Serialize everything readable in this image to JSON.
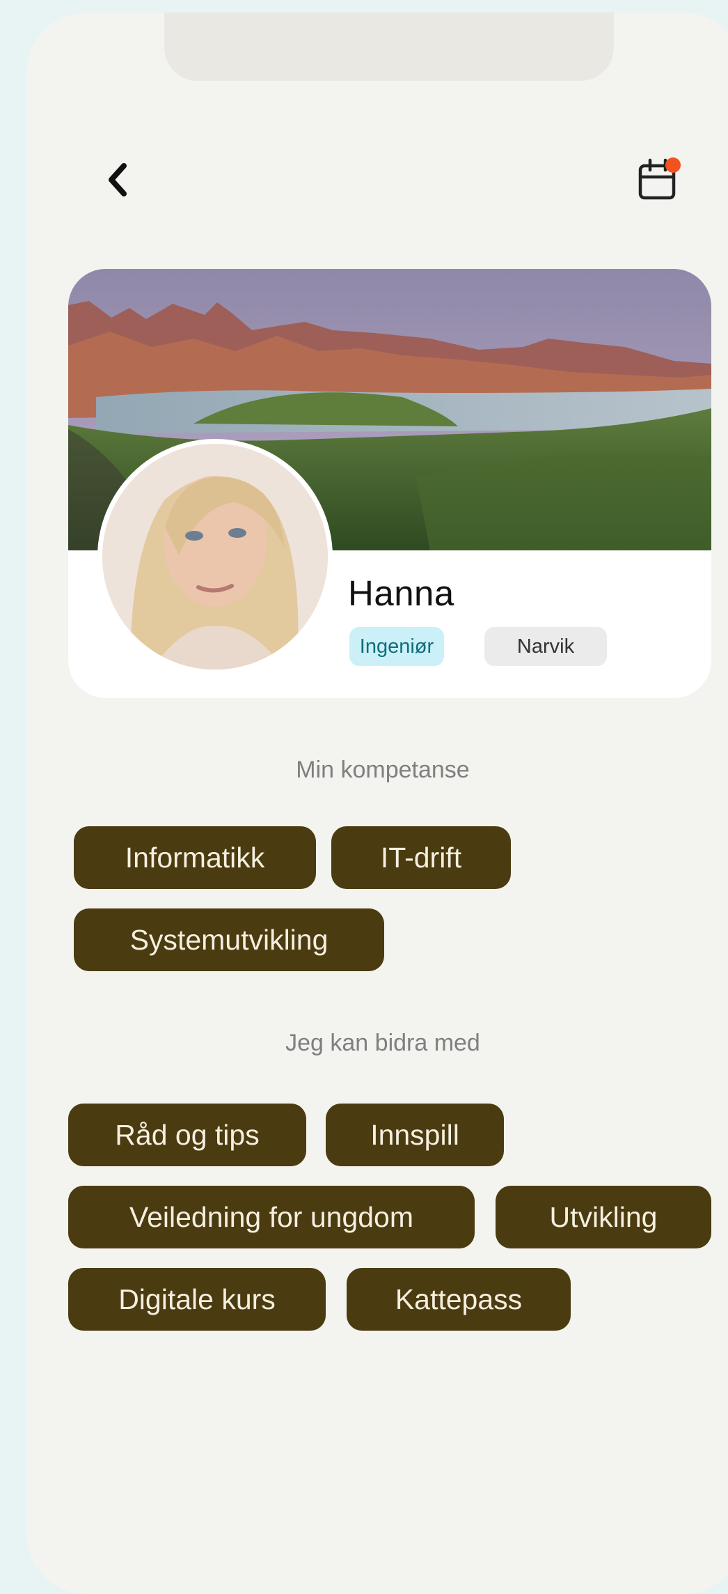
{
  "profile": {
    "name": "Hanna",
    "profession": "Ingeniør",
    "location": "Narvik"
  },
  "icons": {
    "back": "chevron-left-icon",
    "calendar": "calendar-icon",
    "notification_dot_color": "#f2521f"
  },
  "competence": {
    "title": "Min kompetanse",
    "items": [
      "Informatikk",
      "IT-drift",
      "Systemutvikling"
    ]
  },
  "contribute": {
    "title": "Jeg kan bidra med",
    "items": [
      "Råd og tips",
      "Innspill",
      "Veiledning for ungdom",
      "Utvikling",
      "Digitale kurs",
      "Kattepass"
    ]
  },
  "colors": {
    "page_background": "#e8f3f4",
    "screen_background": "#f3f3ef",
    "chip_background": "#4b3b10",
    "chip_text": "#f4efe0",
    "profession_tag_background": "#ccf0f7",
    "profession_tag_text": "#0f6d7c",
    "location_tag_background": "#ebebeb"
  }
}
